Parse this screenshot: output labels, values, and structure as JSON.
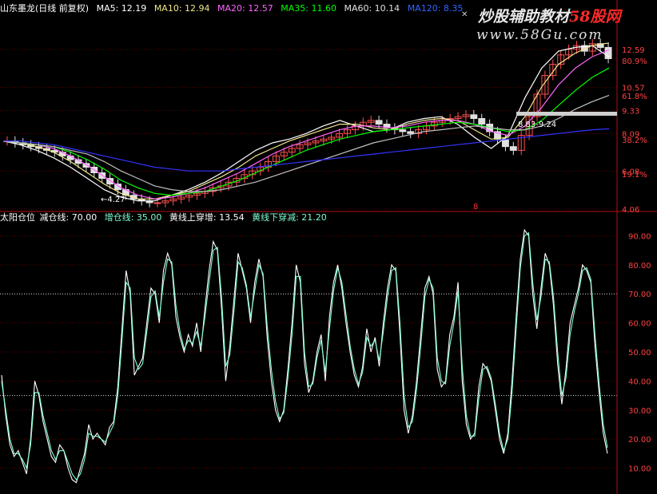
{
  "window": {
    "header": {
      "stock_title": "山东墨龙(日线 前复权)",
      "ma5_label": "MA5: 12.19",
      "ma10_label": "MA10: 12.94",
      "ma20_label": "MA20: 12.57",
      "ma35_label": "MA35: 11.60",
      "ma60_label": "MA60: 10.14",
      "ma120_label": "MA120: 8.35"
    },
    "indicator_header": {
      "name": "太阳仓位",
      "reduce_label": "减仓线: 70.00",
      "add_label": "增仓线: 35.00",
      "yellow_up_label": "黄线上穿增: 13.54",
      "yellow_down_label": "黄线下穿减: 21.20"
    },
    "watermark": {
      "brand_main": "炒股辅助教材",
      "brand_red": "58股网",
      "site": "www.58Gu.com"
    },
    "annotations": {
      "low_marker": "←4.27",
      "range_marker": "8.83-9.24",
      "event_marker": "8"
    },
    "colors": {
      "background": "#000000",
      "axis": "#b01010",
      "white_line": "#ffffff",
      "cyan_line": "#7fffd4",
      "ma5": "#ffffff",
      "ma10": "#f0e68c",
      "ma20": "#ff66ff",
      "ma35": "#00ff00",
      "ma60": "#c0c0c0",
      "ma120": "#3333ff"
    }
  },
  "chart_data": [
    {
      "type": "line",
      "name": "price",
      "y_axis_labels": [
        "12.59",
        "10.57",
        "9.33",
        "8.09",
        "6.08",
        "4.06"
      ],
      "percent_labels": [
        "80.9%",
        "61.8%",
        "38.2%",
        "19.1%"
      ],
      "ylim": [
        4.06,
        12.59
      ],
      "grid": true,
      "candles_approx_close": [
        7.7,
        7.6,
        7.5,
        7.4,
        7.3,
        7.2,
        7.1,
        6.9,
        6.7,
        6.5,
        6.3,
        6.0,
        5.7,
        5.4,
        5.1,
        4.8,
        4.6,
        4.5,
        4.4,
        4.4,
        4.5,
        4.6,
        4.7,
        4.8,
        4.9,
        5.0,
        5.2,
        5.3,
        5.5,
        5.7,
        5.9,
        6.1,
        6.3,
        6.6,
        6.9,
        7.1,
        7.3,
        7.5,
        7.6,
        7.7,
        7.8,
        7.9,
        8.1,
        8.3,
        8.5,
        8.7,
        8.8,
        8.6,
        8.4,
        8.3,
        8.2,
        8.1,
        8.3,
        8.5,
        8.7,
        8.8,
        8.9,
        9.0,
        9.1,
        8.9,
        8.6,
        8.2,
        7.8,
        7.4,
        7.2,
        8.0,
        9.0,
        10.2,
        11.2,
        11.8,
        12.3,
        12.6,
        12.8,
        12.5,
        12.9,
        12.7,
        12.1
      ],
      "series": [
        {
          "name": "MA5",
          "values": [
            7.7,
            7.5,
            7.2,
            6.8,
            6.3,
            5.7,
            5.1,
            4.7,
            4.5,
            4.5,
            4.8,
            5.1,
            5.5,
            6.0,
            6.6,
            7.2,
            7.6,
            7.8,
            8.1,
            8.5,
            8.8,
            8.5,
            8.2,
            8.3,
            8.7,
            8.9,
            9.0,
            8.6,
            7.9,
            7.3,
            8.0,
            10.0,
            11.6,
            12.5,
            12.7,
            12.8,
            12.19
          ]
        },
        {
          "name": "MA10",
          "values": [
            7.7,
            7.6,
            7.4,
            7.1,
            6.6,
            6.0,
            5.4,
            4.9,
            4.6,
            4.6,
            4.8,
            5.0,
            5.4,
            5.8,
            6.3,
            6.9,
            7.3,
            7.7,
            8.0,
            8.3,
            8.6,
            8.6,
            8.4,
            8.3,
            8.6,
            8.8,
            8.9,
            8.8,
            8.3,
            7.8,
            7.9,
            9.0,
            10.6,
            11.8,
            12.4,
            12.8,
            12.94
          ]
        },
        {
          "name": "MA20",
          "values": [
            7.7,
            7.6,
            7.5,
            7.3,
            6.9,
            6.4,
            5.8,
            5.2,
            4.8,
            4.6,
            4.7,
            4.9,
            5.2,
            5.6,
            6.0,
            6.5,
            7.0,
            7.4,
            7.7,
            8.0,
            8.3,
            8.5,
            8.5,
            8.4,
            8.5,
            8.7,
            8.8,
            8.8,
            8.6,
            8.2,
            8.0,
            8.5,
            9.5,
            10.7,
            11.6,
            12.2,
            12.57
          ]
        },
        {
          "name": "MA35",
          "values": [
            7.7,
            7.6,
            7.5,
            7.4,
            7.1,
            6.7,
            6.2,
            5.6,
            5.2,
            4.9,
            4.8,
            4.9,
            5.0,
            5.3,
            5.6,
            6.0,
            6.4,
            6.8,
            7.2,
            7.5,
            7.8,
            8.0,
            8.2,
            8.3,
            8.4,
            8.5,
            8.6,
            8.7,
            8.6,
            8.4,
            8.2,
            8.3,
            8.8,
            9.6,
            10.4,
            11.1,
            11.6
          ]
        },
        {
          "name": "MA60",
          "values": [
            7.7,
            7.6,
            7.5,
            7.4,
            7.2,
            7.0,
            6.6,
            6.1,
            5.7,
            5.3,
            5.1,
            5.0,
            5.0,
            5.1,
            5.3,
            5.5,
            5.8,
            6.1,
            6.4,
            6.7,
            7.0,
            7.3,
            7.6,
            7.8,
            8.0,
            8.2,
            8.3,
            8.4,
            8.5,
            8.4,
            8.3,
            8.3,
            8.5,
            8.9,
            9.4,
            9.8,
            10.14
          ]
        },
        {
          "name": "MA120",
          "values": [
            7.7,
            7.7,
            7.6,
            7.5,
            7.3,
            7.1,
            6.9,
            6.7,
            6.5,
            6.3,
            6.2,
            6.1,
            6.1,
            6.1,
            6.2,
            6.3,
            6.4,
            6.5,
            6.6,
            6.7,
            6.8,
            6.9,
            7.0,
            7.1,
            7.2,
            7.3,
            7.4,
            7.5,
            7.6,
            7.7,
            7.8,
            7.9,
            8.0,
            8.1,
            8.2,
            8.3,
            8.35
          ]
        }
      ]
    },
    {
      "type": "line",
      "name": "indicator",
      "y_axis_labels": [
        "90.00",
        "80.00",
        "70.00",
        "60.00",
        "50.00",
        "40.00",
        "30.00",
        "20.00",
        "10.00"
      ],
      "ylim": [
        3,
        97
      ],
      "reference_lines": [
        70,
        35
      ],
      "grid": true,
      "series": [
        {
          "name": "white",
          "values": [
            42,
            28,
            18,
            14,
            16,
            12,
            8,
            20,
            40,
            35,
            26,
            20,
            14,
            12,
            18,
            16,
            10,
            6,
            5,
            10,
            15,
            25,
            20,
            22,
            20,
            18,
            24,
            26,
            38,
            58,
            78,
            70,
            42,
            45,
            48,
            60,
            72,
            70,
            60,
            78,
            84,
            80,
            62,
            55,
            50,
            56,
            52,
            60,
            50,
            65,
            78,
            88,
            85,
            65,
            40,
            52,
            68,
            84,
            78,
            72,
            60,
            74,
            82,
            76,
            55,
            40,
            30,
            26,
            30,
            44,
            60,
            80,
            74,
            46,
            36,
            40,
            50,
            56,
            40,
            62,
            74,
            80,
            72,
            60,
            50,
            42,
            38,
            45,
            58,
            50,
            55,
            45,
            60,
            72,
            80,
            78,
            56,
            30,
            22,
            28,
            40,
            56,
            72,
            76,
            70,
            44,
            38,
            40,
            56,
            62,
            74,
            40,
            25,
            20,
            22,
            38,
            46,
            44,
            40,
            30,
            20,
            15,
            22,
            40,
            62,
            82,
            92,
            90,
            70,
            58,
            72,
            84,
            80,
            66,
            46,
            32,
            44,
            60,
            66,
            72,
            80,
            78,
            74,
            52,
            36,
            22,
            15
          ]
        },
        {
          "name": "cyan",
          "values": [
            40,
            30,
            20,
            15,
            15,
            13,
            10,
            18,
            36,
            36,
            28,
            22,
            16,
            13,
            16,
            16,
            12,
            8,
            6,
            8,
            13,
            22,
            21,
            21,
            20,
            19,
            22,
            25,
            35,
            54,
            74,
            72,
            48,
            44,
            46,
            57,
            69,
            71,
            62,
            74,
            82,
            81,
            66,
            57,
            51,
            54,
            53,
            57,
            52,
            62,
            74,
            85,
            86,
            69,
            45,
            49,
            64,
            81,
            79,
            73,
            62,
            71,
            80,
            77,
            59,
            44,
            33,
            27,
            29,
            41,
            56,
            76,
            76,
            50,
            38,
            39,
            48,
            54,
            43,
            58,
            71,
            79,
            74,
            63,
            52,
            44,
            39,
            43,
            55,
            52,
            54,
            47,
            57,
            69,
            78,
            79,
            60,
            35,
            24,
            26,
            37,
            52,
            69,
            75,
            72,
            48,
            40,
            39,
            52,
            60,
            71,
            45,
            28,
            21,
            21,
            34,
            44,
            45,
            41,
            32,
            22,
            16,
            20,
            36,
            58,
            79,
            90,
            91,
            74,
            61,
            69,
            82,
            81,
            69,
            50,
            35,
            41,
            56,
            64,
            70,
            78,
            79,
            75,
            56,
            39,
            25,
            17
          ]
        }
      ]
    }
  ]
}
